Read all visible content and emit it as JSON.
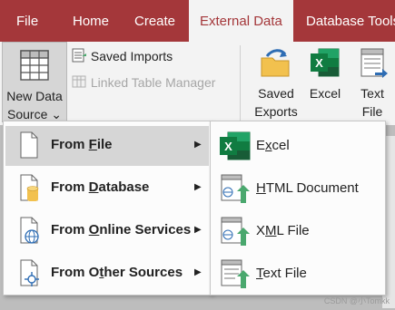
{
  "tabs": [
    {
      "label": "File"
    },
    {
      "label": "Home"
    },
    {
      "label": "Create"
    },
    {
      "label": "External Data",
      "active": true
    },
    {
      "label": "Database Tools"
    }
  ],
  "ribbon": {
    "new_data_source": {
      "line1": "New Data",
      "line2": "Source",
      "caret": "⌄"
    },
    "saved_imports": "Saved Imports",
    "linked_table_manager": "Linked Table Manager",
    "saved_exports": {
      "line1": "Saved",
      "line2": "Exports"
    },
    "excel": "Excel",
    "text_file": {
      "line1": "Text",
      "line2": "File"
    }
  },
  "menu": {
    "items": [
      {
        "pre": "From ",
        "hot": "F",
        "post": "ile",
        "selected": true
      },
      {
        "pre": "From ",
        "hot": "D",
        "post": "atabase"
      },
      {
        "pre": "From ",
        "hot": "O",
        "post": "nline Services"
      },
      {
        "pre": "From O",
        "hot": "t",
        "post": "her Sources"
      }
    ],
    "arrow": "▶"
  },
  "submenu": {
    "items": [
      {
        "pre": "E",
        "hot": "x",
        "post": "cel"
      },
      {
        "pre": "",
        "hot": "H",
        "post": "TML Document"
      },
      {
        "pre": "X",
        "hot": "M",
        "post": "L File"
      },
      {
        "pre": "",
        "hot": "T",
        "post": "ext File"
      }
    ]
  },
  "colors": {
    "accent": "#a4373a",
    "excel_green": "#1d6f42",
    "import_arrow": "#4aa86e",
    "globe_blue": "#2e6db4",
    "db_gold": "#f2c14e"
  },
  "watermark": "CSDN @小Tomkk"
}
